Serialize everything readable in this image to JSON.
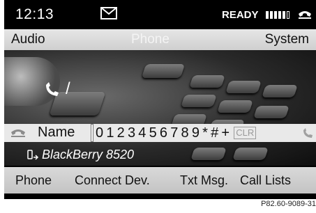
{
  "status": {
    "time": "12:13",
    "status_text": "READY"
  },
  "top_menu": {
    "left": "Audio",
    "center": "Phone",
    "right": "System"
  },
  "input": {
    "field_label": "Name",
    "keys": [
      "0",
      "1",
      "2",
      "3",
      "4",
      "5",
      "6",
      "7",
      "8",
      "9",
      "*",
      "#",
      "+"
    ],
    "clear_label": "CLR"
  },
  "device": {
    "name": "BlackBerry 8520"
  },
  "bottom_menu": {
    "phone": "Phone",
    "connect": "Connect Dev.",
    "txt": "Txt Msg.",
    "calls": "Call Lists"
  },
  "figure_ref": "P82.60-9089-31"
}
